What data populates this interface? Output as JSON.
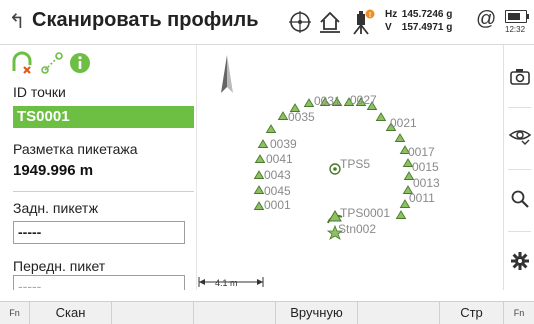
{
  "header": {
    "title": "Сканировать профиль",
    "hz_label": "Hz",
    "hz_value": "145.7246 g",
    "v_label": "V",
    "v_value": "157.4971 g",
    "at_symbol": "@",
    "time": "12:32",
    "status_badge_color": "#f28c1c"
  },
  "left_panel": {
    "point_id_label": "ID точки",
    "point_id_value": "TS0001",
    "stake_label": "Разметка пикетажа",
    "stake_value": "1949.996 m",
    "back_label": "Задн. пикетж",
    "back_value": "-----",
    "front_label": "Передн. пикет",
    "front_value": "-----"
  },
  "map": {
    "labels": {
      "p0031": "0031",
      "p0027": "0027",
      "p0035": "0035",
      "p0021": "0021",
      "p0039": "0039",
      "p0017": "0017",
      "p0041": "0041",
      "p0015": "0015",
      "tps5": "TPS5",
      "p0043": "0043",
      "p0013": "0013",
      "p0045": "0045",
      "p0011": "0011",
      "p0001": "0001",
      "tps0001": "TPS0001",
      "stn002": "Stn002"
    },
    "scale_text": "4.1 m"
  },
  "softkeys": {
    "fn_left": "Fn",
    "scan": "Скан",
    "manual": "Вручную",
    "page": "Стр",
    "fn_right": "Fn"
  },
  "colors": {
    "accent_green": "#6cbf43",
    "point_fill": "#8cc063",
    "station_color": "#4a7a2a"
  }
}
